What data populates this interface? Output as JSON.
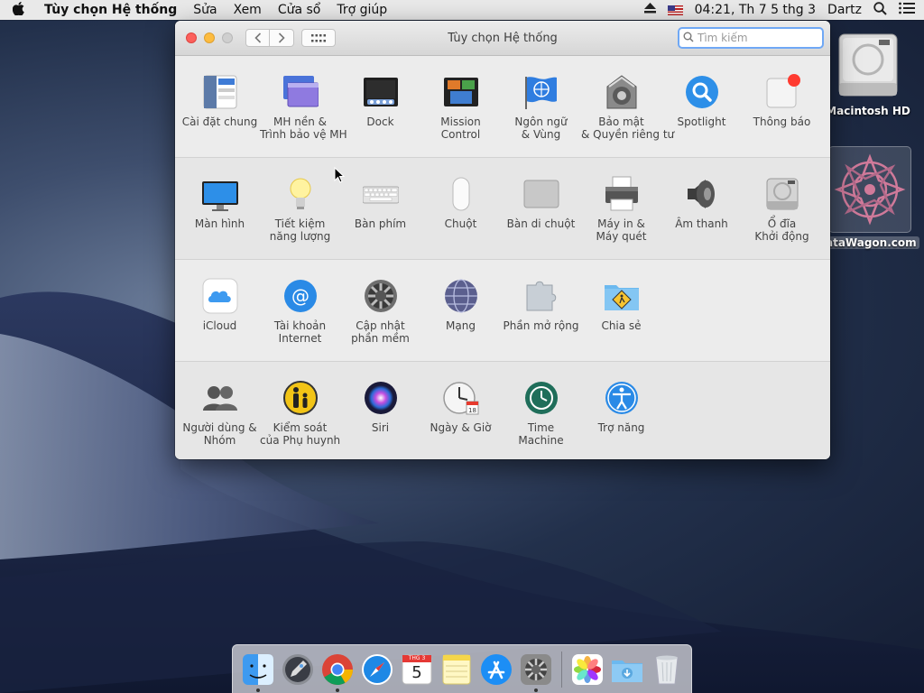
{
  "menubar": {
    "app_name": "Tùy chọn Hệ thống",
    "items": [
      "Sửa",
      "Xem",
      "Cửa sổ",
      "Trợ giúp"
    ],
    "clock": "04:21, Th 7 5 thg 3",
    "user": "Dartz"
  },
  "window": {
    "title": "Tùy chọn Hệ thống",
    "search_placeholder": "Tìm kiếm"
  },
  "sections": [
    {
      "panes": [
        {
          "id": "general",
          "icon": "general-icon",
          "label": [
            "Cài đặt chung"
          ]
        },
        {
          "id": "desktop",
          "icon": "desktop-screensaver-icon",
          "label": [
            "MH nền &",
            "Trình bảo vệ MH"
          ]
        },
        {
          "id": "dock",
          "icon": "dock-icon",
          "label": [
            "Dock"
          ]
        },
        {
          "id": "mission",
          "icon": "mission-control-icon",
          "label": [
            "Mission",
            "Control"
          ]
        },
        {
          "id": "language",
          "icon": "language-region-icon",
          "label": [
            "Ngôn ngữ",
            "& Vùng"
          ]
        },
        {
          "id": "security",
          "icon": "security-privacy-icon",
          "label": [
            "Bảo mật",
            "& Quyền riêng tư"
          ]
        },
        {
          "id": "spotlight",
          "icon": "spotlight-icon",
          "label": [
            "Spotlight"
          ]
        },
        {
          "id": "notifications",
          "icon": "notifications-icon",
          "label": [
            "Thông báo"
          ]
        }
      ]
    },
    {
      "panes": [
        {
          "id": "displays",
          "icon": "displays-icon",
          "label": [
            "Màn hình"
          ]
        },
        {
          "id": "energy",
          "icon": "energy-saver-icon",
          "label": [
            "Tiết kiệm",
            "năng lượng"
          ]
        },
        {
          "id": "keyboard",
          "icon": "keyboard-icon",
          "label": [
            "Bàn phím"
          ]
        },
        {
          "id": "mouse",
          "icon": "mouse-icon",
          "label": [
            "Chuột"
          ]
        },
        {
          "id": "trackpad",
          "icon": "trackpad-icon",
          "label": [
            "Bàn di chuột"
          ]
        },
        {
          "id": "printers",
          "icon": "printers-scanners-icon",
          "label": [
            "Máy in &",
            "Máy quét"
          ]
        },
        {
          "id": "sound",
          "icon": "sound-icon",
          "label": [
            "Âm thanh"
          ]
        },
        {
          "id": "startup",
          "icon": "startup-disk-icon",
          "label": [
            "Ổ đĩa",
            "Khởi động"
          ]
        }
      ]
    },
    {
      "panes": [
        {
          "id": "icloud",
          "icon": "icloud-icon",
          "label": [
            "iCloud"
          ]
        },
        {
          "id": "internet",
          "icon": "internet-accounts-icon",
          "label": [
            "Tài khoản",
            "Internet"
          ]
        },
        {
          "id": "update",
          "icon": "software-update-icon",
          "label": [
            "Cập nhật",
            "phần mềm"
          ]
        },
        {
          "id": "network",
          "icon": "network-icon",
          "label": [
            "Mạng"
          ]
        },
        {
          "id": "extensions",
          "icon": "extensions-icon",
          "label": [
            "Phần mở rộng"
          ]
        },
        {
          "id": "sharing",
          "icon": "sharing-icon",
          "label": [
            "Chia sẻ"
          ]
        }
      ]
    },
    {
      "panes": [
        {
          "id": "users",
          "icon": "users-groups-icon",
          "label": [
            "Người dùng &",
            "Nhóm"
          ]
        },
        {
          "id": "parental",
          "icon": "parental-controls-icon",
          "label": [
            "Kiểm soát",
            "của Phụ huynh"
          ]
        },
        {
          "id": "siri",
          "icon": "siri-icon",
          "label": [
            "Siri"
          ]
        },
        {
          "id": "datetime",
          "icon": "date-time-icon",
          "label": [
            "Ngày & Giờ"
          ]
        },
        {
          "id": "timemachine",
          "icon": "time-machine-icon",
          "label": [
            "Time",
            "Machine"
          ]
        },
        {
          "id": "accessibility",
          "icon": "accessibility-icon",
          "label": [
            "Trợ năng"
          ]
        }
      ]
    }
  ],
  "desktop_icons": [
    {
      "label": "Macintosh HD",
      "icon": "hard-drive-icon"
    },
    {
      "label": "ataWagon.com",
      "icon": "mandala-image-icon"
    }
  ],
  "dock": {
    "apps": [
      "finder-icon",
      "launchpad-icon",
      "chrome-icon",
      "safari-icon",
      "calendar-icon",
      "notes-icon",
      "app-store-icon",
      "system-preferences-icon",
      "photos-icon",
      "downloads-folder-icon",
      "trash-icon"
    ],
    "calendar_month": "THG 3",
    "calendar_day": "5"
  },
  "colors": {
    "accent": "#1a8cf0",
    "search_focus": "#6fa8f5"
  }
}
